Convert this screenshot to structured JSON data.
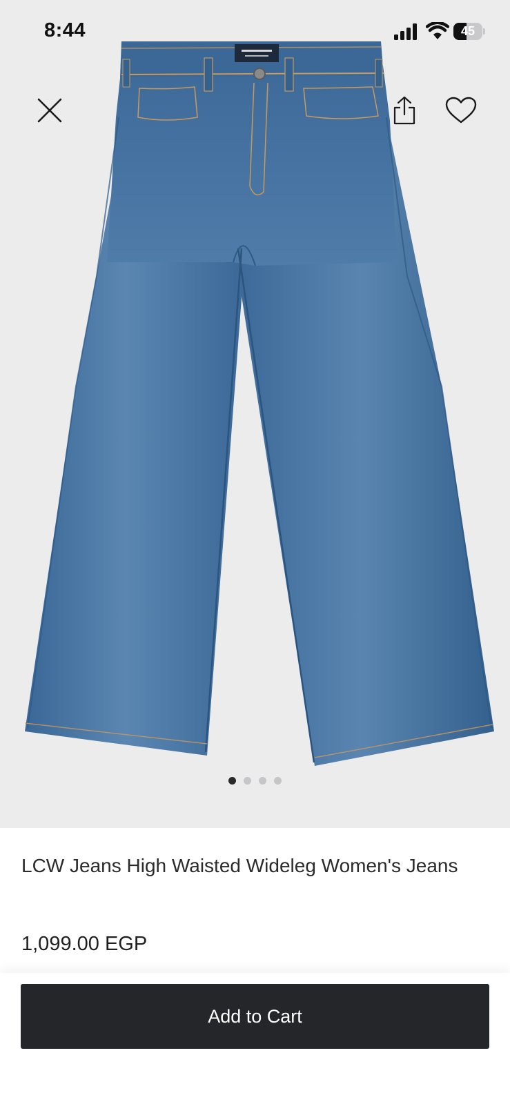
{
  "status_bar": {
    "time": "8:44",
    "battery_level": "45",
    "battery_fraction": 0.45
  },
  "gallery": {
    "image_count": 4,
    "active_index": 0,
    "close_icon": "close-icon",
    "share_icon": "share-icon",
    "favorite_icon": "heart-icon"
  },
  "product": {
    "title": "LCW Jeans High Waisted Wideleg Women's Jeans",
    "price": "1,099.00 EGP"
  },
  "cart": {
    "add_label": "Add to Cart"
  },
  "colors": {
    "gallery_bg": "#ececed",
    "denim": "#3f6d9d",
    "button_bg": "#24262a"
  }
}
